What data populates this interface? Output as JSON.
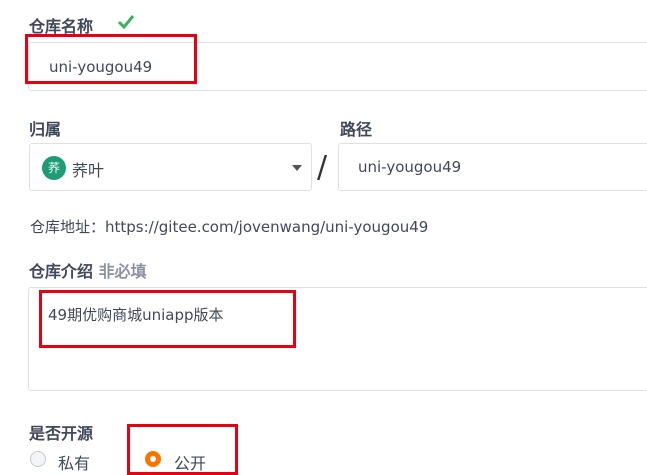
{
  "repo_name": {
    "label": "仓库名称",
    "value": "uni-yougou49",
    "valid_icon": "check-icon"
  },
  "owner": {
    "label": "归属",
    "avatar_text": "荞",
    "value": "荞叶",
    "caret_icon": "caret-down-icon"
  },
  "separator": "/",
  "path": {
    "label": "路径",
    "value": "uni-yougou49"
  },
  "address": {
    "text": "仓库地址：https://gitee.com/jovenwang/uni-yougou49"
  },
  "description": {
    "label": "仓库介绍",
    "optional": "非必填",
    "value": "49期优购商城uniapp版本"
  },
  "visibility": {
    "label": "是否开源",
    "options": [
      {
        "label": "私有",
        "selected": false
      },
      {
        "label": "公开",
        "selected": true
      }
    ]
  },
  "colors": {
    "accent": "#fe7300",
    "check": "#3eaf5c",
    "highlight": "#e60012"
  }
}
